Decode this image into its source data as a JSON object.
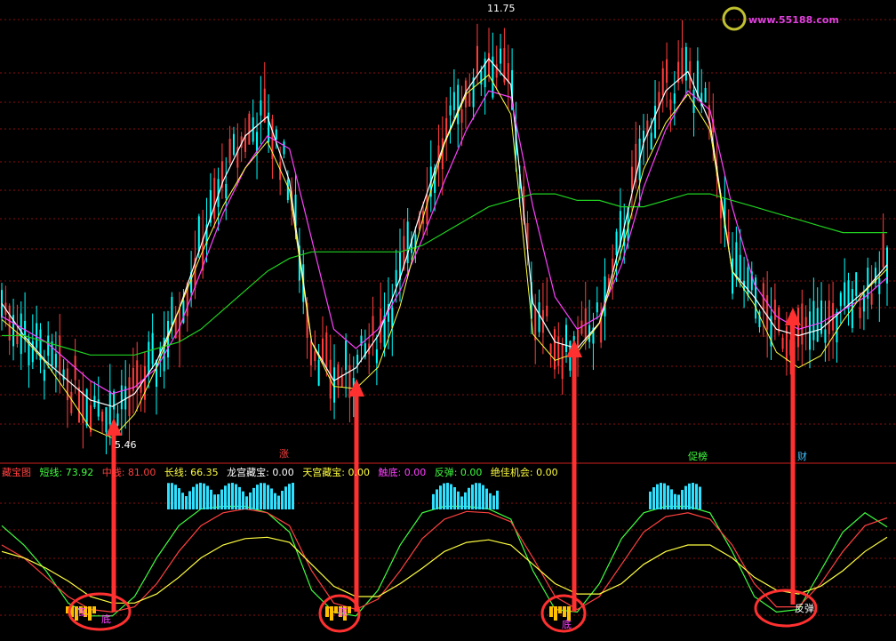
{
  "watermark": "www.55188.com",
  "top_chart": {
    "type": "candlestick",
    "high_label": "11.75",
    "low_label": "5.46",
    "event_markers": [
      "涨",
      "促榜",
      "财"
    ],
    "colors": {
      "up": "#ff3c3c",
      "down": "#00ffff",
      "ma_white": "#ffffff",
      "ma_yellow": "#ffff40",
      "ma_magenta": "#ff40ff",
      "ma_green": "#20d020"
    }
  },
  "indicator": {
    "name": "藏宝图",
    "fields": [
      {
        "label": "短线: ",
        "value": "73.92",
        "color": "#40ff40"
      },
      {
        "label": "中线: ",
        "value": "81.00",
        "color": "#ff4040"
      },
      {
        "label": "长线: ",
        "value": "66.35",
        "color": "#ffff40"
      },
      {
        "label": "龙宫藏宝: ",
        "value": "0.00",
        "color": "#ffffff"
      },
      {
        "label": "天宫藏宝: ",
        "value": "0.00",
        "color": "#ffff40"
      },
      {
        "label": "触底: ",
        "value": "0.00",
        "color": "#ff40ff"
      },
      {
        "label": "反弹: ",
        "value": "0.00",
        "color": "#40ff40"
      },
      {
        "label": "绝佳机会: ",
        "value": "0.00",
        "color": "#ffff40"
      }
    ],
    "signal_labels": [
      "底",
      "底",
      "底",
      "底",
      "反弹"
    ]
  },
  "chart_data": {
    "type": "line",
    "title": "",
    "price_high": 11.75,
    "price_low": 5.46,
    "series": [
      {
        "color": "#ffffff",
        "values": [
          7.4,
          6.9,
          6.5,
          6.2,
          5.9,
          5.8,
          6.0,
          6.5,
          7.3,
          8.3,
          9.3,
          10.0,
          10.3,
          9.3,
          6.8,
          6.2,
          6.4,
          6.9,
          7.8,
          8.9,
          9.9,
          10.7,
          11.2,
          10.8,
          7.4,
          6.8,
          6.7,
          7.1,
          8.4,
          9.9,
          10.7,
          11.0,
          10.2,
          7.9,
          7.5,
          7.0,
          6.9,
          7.0,
          7.3,
          7.6,
          8.0
        ]
      },
      {
        "color": "#ff40ff",
        "values": [
          7.2,
          7.0,
          6.8,
          6.5,
          6.2,
          6.0,
          6.1,
          6.4,
          7.0,
          7.9,
          8.8,
          9.5,
          10.0,
          9.8,
          8.4,
          7.0,
          6.7,
          7.0,
          7.6,
          8.4,
          9.3,
          10.1,
          10.7,
          10.6,
          8.9,
          7.5,
          7.0,
          7.2,
          8.0,
          9.2,
          10.1,
          10.7,
          10.4,
          8.9,
          7.7,
          7.2,
          7.0,
          7.1,
          7.3,
          7.5,
          7.8
        ]
      },
      {
        "color": "#20d020",
        "values": [
          6.9,
          6.9,
          6.8,
          6.7,
          6.6,
          6.6,
          6.6,
          6.7,
          6.8,
          7.0,
          7.3,
          7.6,
          7.9,
          8.1,
          8.2,
          8.2,
          8.2,
          8.2,
          8.2,
          8.3,
          8.5,
          8.7,
          8.9,
          9.0,
          9.1,
          9.1,
          9.0,
          9.0,
          8.9,
          8.9,
          9.0,
          9.1,
          9.1,
          9.0,
          8.9,
          8.8,
          8.7,
          8.6,
          8.5,
          8.5,
          8.5
        ]
      }
    ],
    "indicator_series": [
      {
        "name": "短线",
        "color": "#40ff40",
        "values": [
          75,
          60,
          40,
          15,
          5,
          5,
          20,
          50,
          75,
          88,
          90,
          90,
          85,
          70,
          25,
          8,
          5,
          25,
          60,
          85,
          90,
          90,
          88,
          80,
          40,
          10,
          8,
          30,
          65,
          85,
          90,
          90,
          85,
          55,
          20,
          8,
          10,
          40,
          70,
          85,
          74
        ]
      },
      {
        "name": "中线",
        "color": "#ff4040",
        "values": [
          60,
          50,
          35,
          20,
          10,
          8,
          12,
          30,
          55,
          75,
          85,
          88,
          85,
          75,
          40,
          15,
          10,
          18,
          40,
          65,
          80,
          86,
          85,
          78,
          50,
          20,
          10,
          20,
          45,
          70,
          82,
          85,
          80,
          60,
          30,
          12,
          12,
          30,
          55,
          75,
          81
        ]
      },
      {
        "name": "长线",
        "color": "#ffff40",
        "values": [
          55,
          50,
          42,
          32,
          20,
          15,
          15,
          22,
          35,
          50,
          60,
          65,
          66,
          62,
          45,
          28,
          20,
          20,
          30,
          42,
          55,
          62,
          64,
          60,
          45,
          30,
          22,
          22,
          30,
          45,
          55,
          60,
          60,
          50,
          35,
          25,
          22,
          28,
          40,
          55,
          66
        ]
      }
    ]
  }
}
